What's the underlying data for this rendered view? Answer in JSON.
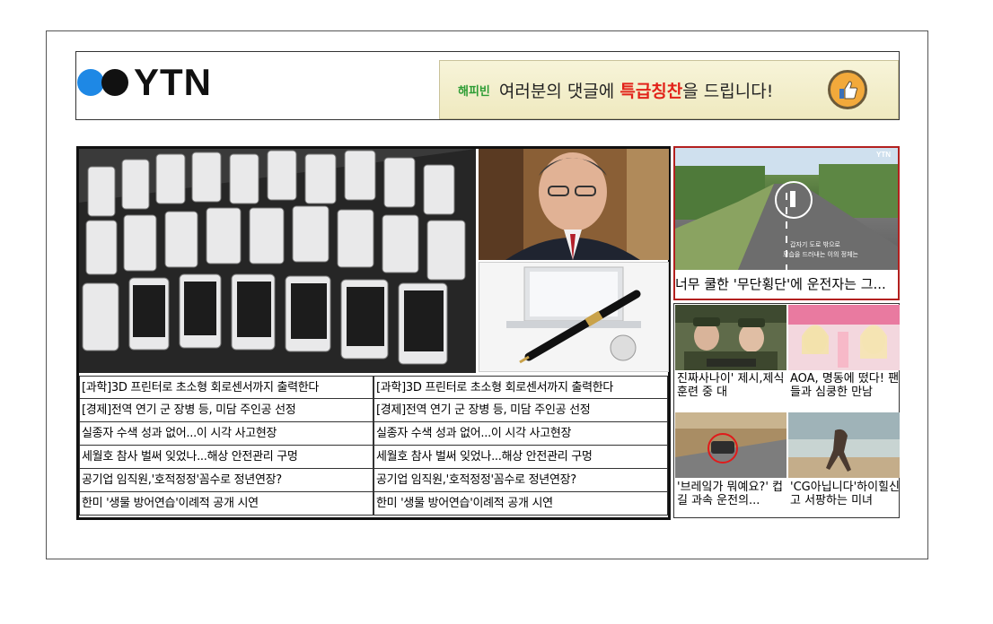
{
  "logo": {
    "text": "YTN",
    "dot_colors": [
      "#1e88e5",
      "#111111"
    ]
  },
  "banner": {
    "brand": "해피빈",
    "text_before": "여러분의 댓글에 ",
    "highlight": "특급칭찬",
    "text_after": "을 드립니다!",
    "icon": "thumbs-up-icon"
  },
  "main_news": {
    "left_column": [
      "[과학]3D 프린터로 초소형 회로센서까지 출력한다",
      "[경제]전역 연기 군 장병 등, 미담 주인공 선정",
      "실종자 수색 성과 없어...이 시각 사고현장",
      "세월호 참사 벌써 잊었나...해상 안전관리 구멍",
      "공기업 임직원,'호적정정'꼼수로 정년연장?",
      "한미 '생물 방어연습'이례적 공개 시연"
    ],
    "right_column": [
      "[과학]3D 프린터로 초소형 회로센서까지 출력한다",
      "[경제]전역 연기 군 장병 등, 미담 주인공 선정",
      "실종자 수색 성과 없어...이 시각 사고현장",
      "세월호 참사 벌써 잊었나...해상 안전관리 구멍",
      "공기업 임직원,'호적정정'꼼수로 정년연장?",
      "한미 '생물 방어연습'이례적 공개 시연"
    ]
  },
  "side_news": {
    "featured_caption": "너무 쿨한 '무단횡단'에 운전자는 그...",
    "featured_overlay": [
      "갑자기 도로 밖으로",
      "모습을 드러내는 이의 정체는"
    ],
    "featured_watermark": "YTN",
    "tiles": [
      {
        "caption": "진짜사나이' 제시,제식훈련 중 대"
      },
      {
        "caption": "AOA, 명동에 떴다! 팬들과 심쿵한 만남"
      },
      {
        "caption": "'브레잌가 뭐예요?' 컵길 과속 운전의..."
      },
      {
        "caption": "'CG아닙니다'하이힐신고 서팡하는 미녀"
      }
    ]
  }
}
